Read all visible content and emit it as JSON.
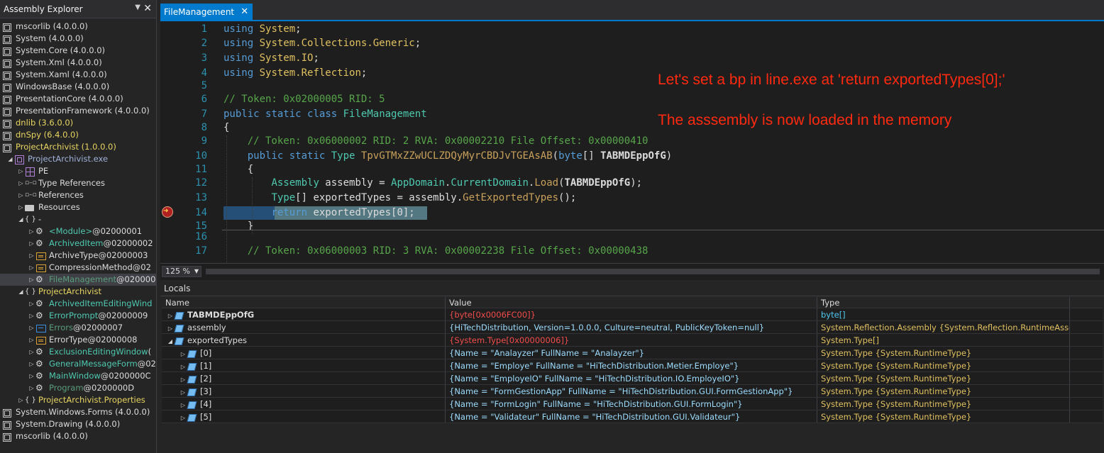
{
  "explorer": {
    "title": "Assembly Explorer",
    "items": [
      {
        "label": "mscorlib (4.0.0.0)",
        "indent": 0,
        "icon": "assembly-icon",
        "color": "white"
      },
      {
        "label": "System (4.0.0.0)",
        "indent": 0,
        "icon": "assembly-icon",
        "color": "white"
      },
      {
        "label": "System.Core (4.0.0.0)",
        "indent": 0,
        "icon": "assembly-icon",
        "color": "white"
      },
      {
        "label": "System.Xml (4.0.0.0)",
        "indent": 0,
        "icon": "assembly-icon",
        "color": "white"
      },
      {
        "label": "System.Xaml (4.0.0.0)",
        "indent": 0,
        "icon": "assembly-icon",
        "color": "white"
      },
      {
        "label": "WindowsBase (4.0.0.0)",
        "indent": 0,
        "icon": "assembly-icon",
        "color": "white"
      },
      {
        "label": "PresentationCore (4.0.0.0)",
        "indent": 0,
        "icon": "assembly-icon",
        "color": "white"
      },
      {
        "label": "PresentationFramework (4.0.0.0)",
        "indent": 0,
        "icon": "assembly-icon",
        "color": "white"
      },
      {
        "label": "dnlib (3.6.0.0)",
        "indent": 0,
        "icon": "assembly-icon",
        "color": "yellow"
      },
      {
        "label": "dnSpy (6.4.0.0)",
        "indent": 0,
        "icon": "assembly-icon",
        "color": "yellow"
      },
      {
        "label": "ProjectArchivist (1.0.0.0)",
        "indent": 0,
        "icon": "assembly-icon",
        "color": "yellow",
        "arrow": "◢"
      },
      {
        "label": "ProjectArchivist.exe",
        "indent": 1,
        "icon": "exe-icon",
        "color": "purple",
        "arrow": "◢"
      },
      {
        "label": "PE",
        "indent": 2,
        "icon": "pe-icon",
        "color": "white",
        "arrow": "▷"
      },
      {
        "label": "Type References",
        "indent": 2,
        "icon": "references-icon",
        "color": "white",
        "arrow": "▷"
      },
      {
        "label": "References",
        "indent": 2,
        "icon": "references-icon",
        "color": "white",
        "arrow": "▷"
      },
      {
        "label": "Resources",
        "indent": 2,
        "icon": "folder-icon",
        "color": "white",
        "arrow": "▷"
      },
      {
        "label": "-",
        "indent": 2,
        "icon": "namespace-icon",
        "color": "white",
        "arrow": "◢"
      },
      {
        "label": "<Module>",
        "suffix": " @02000001",
        "indent": 3,
        "icon": "class-icon",
        "color": "green",
        "arrow": "▷"
      },
      {
        "label": "ArchivedItem",
        "suffix": " @02000002",
        "indent": 3,
        "icon": "class-icon",
        "color": "green",
        "arrow": "▷"
      },
      {
        "label": "ArchiveType",
        "suffix": " @02000003",
        "indent": 3,
        "icon": "enum-icon",
        "color": "white",
        "arrow": "▷"
      },
      {
        "label": "CompressionMethod",
        "suffix": " @02",
        "indent": 3,
        "icon": "enum-icon",
        "color": "white",
        "arrow": "▷"
      },
      {
        "label": "FileManagement",
        "suffix": " @020000",
        "indent": 3,
        "icon": "class-icon",
        "color": "dgreen",
        "arrow": "▷",
        "selected": true
      },
      {
        "label": "ProjectArchivist",
        "indent": 2,
        "icon": "namespace-icon",
        "color": "yellow",
        "arrow": "◢"
      },
      {
        "label": "ArchivedItemEditingWind",
        "indent": 3,
        "icon": "class-icon",
        "color": "green",
        "arrow": "▷"
      },
      {
        "label": "ErrorPrompt",
        "suffix": " @02000009",
        "indent": 3,
        "icon": "class-icon",
        "color": "green",
        "arrow": "▷"
      },
      {
        "label": "Errors",
        "suffix": " @02000007",
        "indent": 3,
        "icon": "interface-icon",
        "color": "dgreen",
        "arrow": "▷"
      },
      {
        "label": "ErrorType",
        "suffix": " @02000008",
        "indent": 3,
        "icon": "enum-icon",
        "color": "white",
        "arrow": "▷"
      },
      {
        "label": "ExclusionEditingWindow",
        "suffix": " (",
        "indent": 3,
        "icon": "class-icon",
        "color": "green",
        "arrow": "▷"
      },
      {
        "label": "GeneralMessageForm",
        "suffix": " @02",
        "indent": 3,
        "icon": "class-icon",
        "color": "green",
        "arrow": "▷"
      },
      {
        "label": "MainWindow",
        "suffix": " @0200000C",
        "indent": 3,
        "icon": "class-icon",
        "color": "green",
        "arrow": "▷"
      },
      {
        "label": "Program",
        "suffix": " @0200000D",
        "indent": 3,
        "icon": "class-icon",
        "color": "dgreen",
        "arrow": "▷"
      },
      {
        "label": "ProjectArchivist.Properties",
        "indent": 2,
        "icon": "namespace-icon",
        "color": "yellow",
        "arrow": "▷"
      },
      {
        "label": "System.Windows.Forms (4.0.0.0)",
        "indent": 0,
        "icon": "assembly-icon",
        "color": "white"
      },
      {
        "label": "System.Drawing (4.0.0.0)",
        "indent": 0,
        "icon": "assembly-icon",
        "color": "white"
      },
      {
        "label": "mscorlib (4.0.0.0)",
        "indent": 0,
        "icon": "assembly-icon",
        "color": "white"
      }
    ]
  },
  "editor": {
    "tab_label": "FileManagement",
    "zoom": "125 %",
    "line_numbers": [
      "1",
      "2",
      "3",
      "4",
      "5",
      "6",
      "7",
      "8",
      "9",
      "10",
      "11",
      "12",
      "13",
      "14",
      "15",
      "16",
      "17"
    ],
    "overlay_line1": "Let's set a bp in line.exe at 'return exportedTypes[0];'",
    "overlay_line2": "The asssembly is now loaded in the memory"
  },
  "locals": {
    "title": "Locals",
    "columns": [
      "Name",
      "Value",
      "Type"
    ],
    "rows": [
      {
        "name": "TABMDEppOfG",
        "value": "{byte[0x0006FC00]}",
        "type": "byte[]",
        "bold": true,
        "expander": "▷",
        "child": false
      },
      {
        "name": "assembly",
        "value": "{HiTechDistribution, Version=1.0.0.0, Culture=neutral, PublicKeyToken=null}",
        "type": "System.Reflection.Assembly {System.Reflection.RuntimeAssem…",
        "bold": false,
        "expander": "▷",
        "child": false
      },
      {
        "name": "exportedTypes",
        "value": "{System.Type[0x00000006]}",
        "type": "System.Type[]",
        "bold": false,
        "expander": "◢",
        "child": false
      },
      {
        "name": "[0]",
        "value": "{Name = \"Analayzer\" FullName = \"Analayzer\"}",
        "type": "System.Type {System.RuntimeType}",
        "bold": false,
        "expander": "▷",
        "child": true
      },
      {
        "name": "[1]",
        "value": "{Name = \"Employe\" FullName = \"HiTechDistribution.Metier.Employe\"}",
        "type": "System.Type {System.RuntimeType}",
        "bold": false,
        "expander": "▷",
        "child": true
      },
      {
        "name": "[2]",
        "value": "{Name = \"EmployeIO\" FullName = \"HiTechDistribution.IO.EmployeIO\"}",
        "type": "System.Type {System.RuntimeType}",
        "bold": false,
        "expander": "▷",
        "child": true
      },
      {
        "name": "[3]",
        "value": "{Name = \"FormGestionApp\" FullName = \"HiTechDistribution.GUI.FormGestionApp\"}",
        "type": "System.Type {System.RuntimeType}",
        "bold": false,
        "expander": "▷",
        "child": true
      },
      {
        "name": "[4]",
        "value": "{Name = \"FormLogin\" FullName = \"HiTechDistribution.GUI.FormLogin\"}",
        "type": "System.Type {System.RuntimeType}",
        "bold": false,
        "expander": "▷",
        "child": true
      },
      {
        "name": "[5]",
        "value": "{Name = \"Validateur\" FullName = \"HiTechDistribution.GUI.Validateur\"}",
        "type": "System.Type {System.RuntimeType}",
        "bold": false,
        "expander": "▷",
        "child": true
      }
    ]
  },
  "colors": {
    "accent": "#007acc",
    "overlay_text": "#ff2a10",
    "editor_bg": "#1e1e1e",
    "panel_bg": "#252526"
  }
}
